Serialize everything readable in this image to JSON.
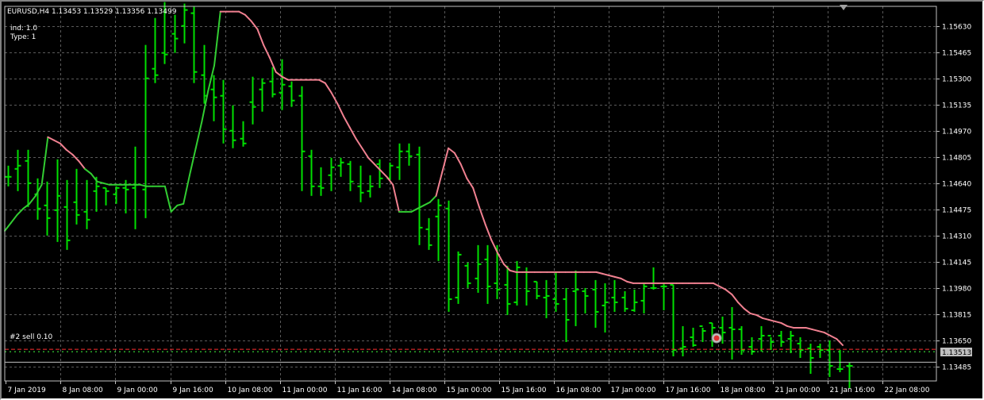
{
  "header": {
    "title": "EURUSD,H4  1.13453 1.13529 1.13356 1.13499"
  },
  "indicator": {
    "line1": "ind: 1.0",
    "line2": "Type: 1"
  },
  "order": {
    "label": "#2 sell 0.10",
    "price": 1.13594
  },
  "current_price": {
    "label": "1.13513",
    "value": 1.13513
  },
  "colors": {
    "background": "#000000",
    "grid": "#5a5a5a",
    "bars": "#00e000",
    "line_down": "#f08090",
    "line_up": "#32cd32",
    "order_line": "#ff3030",
    "bid_line": "#c0c0c0"
  },
  "icons": {
    "trade_marker": "trade-arrow-icon",
    "shift_marker": "chart-shift-triangle-icon"
  },
  "chart_data": {
    "type": "ohlc",
    "symbol": "EURUSD",
    "timeframe": "H4",
    "price_ticks": [
      1.1563,
      1.15465,
      1.153,
      1.15135,
      1.1497,
      1.14805,
      1.1464,
      1.14475,
      1.1431,
      1.14145,
      1.1398,
      1.13815,
      1.1365,
      1.13485
    ],
    "time_labels": [
      "7 Jan 2019",
      "8 Jan 08:00",
      "9 Jan 00:00",
      "9 Jan 16:00",
      "10 Jan 08:00",
      "11 Jan 00:00",
      "11 Jan 16:00",
      "14 Jan 08:00",
      "15 Jan 00:00",
      "15 Jan 16:00",
      "16 Jan 08:00",
      "17 Jan 00:00",
      "17 Jan 16:00",
      "18 Jan 08:00",
      "21 Jan 00:00",
      "21 Jan 16:00",
      "22 Jan 08:00"
    ],
    "ylim": [
      1.13395,
      1.15753
    ],
    "bars": [
      [
        1.1468,
        1.1475,
        1.1462,
        1.1468
      ],
      [
        1.1473,
        1.1485,
        1.1459,
        1.1475
      ],
      [
        1.1478,
        1.1485,
        1.1449,
        1.1464
      ],
      [
        1.1457,
        1.1467,
        1.1441,
        1.1448
      ],
      [
        1.145,
        1.1465,
        1.1431,
        1.1442
      ],
      [
        1.1447,
        1.1479,
        1.1427,
        1.1456
      ],
      [
        1.1449,
        1.1466,
        1.1422,
        1.1428
      ],
      [
        1.1452,
        1.1473,
        1.1438,
        1.1444
      ],
      [
        1.1446,
        1.1466,
        1.1435,
        1.1441
      ],
      [
        1.1459,
        1.1468,
        1.1446,
        1.1462
      ],
      [
        1.1461,
        1.1461,
        1.145,
        1.1459
      ],
      [
        1.1457,
        1.1462,
        1.1451,
        1.1461
      ],
      [
        1.1461,
        1.1466,
        1.1445,
        1.146
      ],
      [
        1.1461,
        1.1487,
        1.1435,
        1.1463
      ],
      [
        1.146,
        1.1551,
        1.1442,
        1.153
      ],
      [
        1.1536,
        1.1568,
        1.1527,
        1.1532
      ],
      [
        1.1546,
        1.1578,
        1.1539,
        1.1545
      ],
      [
        1.1558,
        1.157,
        1.1546,
        1.1555
      ],
      [
        1.1563,
        1.1577,
        1.1552,
        1.1573
      ],
      [
        1.1571,
        1.1575,
        1.1527,
        1.1534
      ],
      [
        1.1532,
        1.1551,
        1.1514,
        1.1519
      ],
      [
        1.1523,
        1.1532,
        1.1503,
        1.1518
      ],
      [
        1.1519,
        1.1529,
        1.1489,
        1.1498
      ],
      [
        1.1497,
        1.1513,
        1.1486,
        1.1491
      ],
      [
        1.1492,
        1.1503,
        1.1487,
        1.1489
      ],
      [
        1.1515,
        1.1531,
        1.1501,
        1.1512
      ],
      [
        1.1523,
        1.153,
        1.1509,
        1.1527
      ],
      [
        1.1528,
        1.1537,
        1.1518,
        1.152
      ],
      [
        1.1521,
        1.1542,
        1.151,
        1.1526
      ],
      [
        1.1525,
        1.1528,
        1.1512,
        1.1516
      ],
      [
        1.1519,
        1.1525,
        1.1459,
        1.1484
      ],
      [
        1.1481,
        1.1485,
        1.1456,
        1.1462
      ],
      [
        1.1462,
        1.1474,
        1.1456,
        1.1461
      ],
      [
        1.1469,
        1.148,
        1.1459,
        1.1474
      ],
      [
        1.1475,
        1.148,
        1.1468,
        1.1477
      ],
      [
        1.1476,
        1.1478,
        1.1459,
        1.1465
      ],
      [
        1.1462,
        1.1475,
        1.1452,
        1.1458
      ],
      [
        1.1459,
        1.1469,
        1.1455,
        1.1462
      ],
      [
        1.1476,
        1.1479,
        1.1461,
        1.1467
      ],
      [
        1.1467,
        1.1477,
        1.1466,
        1.1475
      ],
      [
        1.1474,
        1.1489,
        1.1466,
        1.1484
      ],
      [
        1.1484,
        1.1489,
        1.1475,
        1.1481
      ],
      [
        1.1482,
        1.1487,
        1.1425,
        1.1436
      ],
      [
        1.1435,
        1.1442,
        1.1422,
        1.1425
      ],
      [
        1.1443,
        1.1454,
        1.1415,
        1.145
      ],
      [
        1.1448,
        1.1453,
        1.1383,
        1.1391
      ],
      [
        1.1392,
        1.1421,
        1.1388,
        1.1419
      ],
      [
        1.1412,
        1.1414,
        1.1398,
        1.1401
      ],
      [
        1.1404,
        1.1425,
        1.1395,
        1.1413
      ],
      [
        1.1416,
        1.1425,
        1.1388,
        1.1399
      ],
      [
        1.1401,
        1.1425,
        1.1391,
        1.1397
      ],
      [
        1.14,
        1.1412,
        1.1381,
        1.1388
      ],
      [
        1.1389,
        1.1415,
        1.1387,
        1.1411
      ],
      [
        1.1408,
        1.1411,
        1.1387,
        1.1396
      ],
      [
        1.1402,
        1.1402,
        1.1391,
        1.1393
      ],
      [
        1.1392,
        1.1403,
        1.1379,
        1.1393
      ],
      [
        1.1391,
        1.1408,
        1.1383,
        1.1388
      ],
      [
        1.1391,
        1.1398,
        1.1364,
        1.1378
      ],
      [
        1.1396,
        1.1409,
        1.1374,
        1.1397
      ],
      [
        1.1396,
        1.1398,
        1.1382,
        1.1393
      ],
      [
        1.1397,
        1.1403,
        1.1373,
        1.1383
      ],
      [
        1.1387,
        1.1401,
        1.137,
        1.1389
      ],
      [
        1.1392,
        1.1403,
        1.1383,
        1.1389
      ],
      [
        1.1392,
        1.1396,
        1.1383,
        1.1385
      ],
      [
        1.1384,
        1.1397,
        1.1383,
        1.1389
      ],
      [
        1.139,
        1.1401,
        1.1382,
        1.1399
      ],
      [
        1.1398,
        1.1411,
        1.1397,
        1.1398
      ],
      [
        1.1399,
        1.1401,
        1.1384,
        1.1399
      ],
      [
        1.14,
        1.14,
        1.1355,
        1.1359
      ],
      [
        1.136,
        1.1374,
        1.1355,
        1.1361
      ],
      [
        1.1367,
        1.1373,
        1.1361,
        1.1362
      ],
      [
        1.1374,
        1.1373,
        1.1364,
        1.1371
      ],
      [
        1.1376,
        1.1376,
        1.1361,
        1.1373
      ],
      [
        1.1373,
        1.138,
        1.1363,
        1.137
      ],
      [
        1.1373,
        1.1386,
        1.1353,
        1.1372
      ],
      [
        1.1372,
        1.1374,
        1.1356,
        1.1359
      ],
      [
        1.1361,
        1.1367,
        1.1356,
        1.1358
      ],
      [
        1.1366,
        1.1374,
        1.1358,
        1.1368
      ],
      [
        1.1368,
        1.1367,
        1.1359,
        1.1364
      ],
      [
        1.1368,
        1.1371,
        1.1361,
        1.1364
      ],
      [
        1.1366,
        1.1371,
        1.1357,
        1.1368
      ],
      [
        1.1363,
        1.1367,
        1.1354,
        1.1359
      ],
      [
        1.136,
        1.1363,
        1.1344,
        1.1354
      ],
      [
        1.1361,
        1.1363,
        1.1354,
        1.1359
      ],
      [
        1.1359,
        1.1365,
        1.1342,
        1.1349
      ],
      [
        1.1347,
        1.1359,
        1.1345,
        1.1347
      ],
      [
        1.1349,
        1.1351,
        1.1335,
        1.1349
      ]
    ],
    "line": [
      1.1434,
      1.1439,
      1.1444,
      1.1448,
      1.1451,
      1.1456,
      1.1463,
      1.1493,
      1.1491,
      1.1489,
      1.1485,
      1.1482,
      1.1478,
      1.1473,
      1.147,
      1.1465,
      1.1464,
      1.1463,
      1.1463,
      1.1463,
      1.1463,
      1.1463,
      1.1463,
      1.1462,
      1.1462,
      1.1462,
      1.1462,
      1.1446,
      1.145,
      1.1451,
      1.1469,
      1.1486,
      1.1503,
      1.1522,
      1.1538,
      1.1572,
      1.1572,
      1.1572,
      1.1572,
      1.157,
      1.1566,
      1.1561,
      1.1551,
      1.1543,
      1.1534,
      1.1531,
      1.1529,
      1.1529,
      1.1529,
      1.1529,
      1.1529,
      1.1529,
      1.1527,
      1.1521,
      1.1514,
      1.1506,
      1.1499,
      1.1492,
      1.1486,
      1.148,
      1.1476,
      1.1472,
      1.1468,
      1.1463,
      1.1446,
      1.1446,
      1.1446,
      1.1448,
      1.145,
      1.1452,
      1.1456,
      1.1471,
      1.1486,
      1.1483,
      1.1476,
      1.1467,
      1.1461,
      1.1449,
      1.1438,
      1.1428,
      1.142,
      1.1413,
      1.1409,
      1.1408,
      1.1408,
      1.1408,
      1.1408,
      1.1408,
      1.1408,
      1.1408,
      1.1408,
      1.1408,
      1.1408,
      1.1408,
      1.1408,
      1.1408,
      1.1408,
      1.1407,
      1.1406,
      1.1405,
      1.1404,
      1.1402,
      1.1401,
      1.1401,
      1.1401,
      1.1401,
      1.1401,
      1.1401,
      1.1401,
      1.1401,
      1.1401,
      1.1401,
      1.1401,
      1.1401,
      1.1401,
      1.1401,
      1.1399,
      1.1397,
      1.1394,
      1.1389,
      1.1385,
      1.1382,
      1.1381,
      1.1379,
      1.1378,
      1.1377,
      1.1376,
      1.1374,
      1.1373,
      1.1373,
      1.1373,
      1.1372,
      1.1371,
      1.137,
      1.1368,
      1.1366,
      1.1362
    ],
    "line_up_segments": [
      [
        0,
        7
      ],
      [
        13,
        26
      ],
      [
        26,
        35
      ],
      [
        64,
        70
      ]
    ]
  }
}
